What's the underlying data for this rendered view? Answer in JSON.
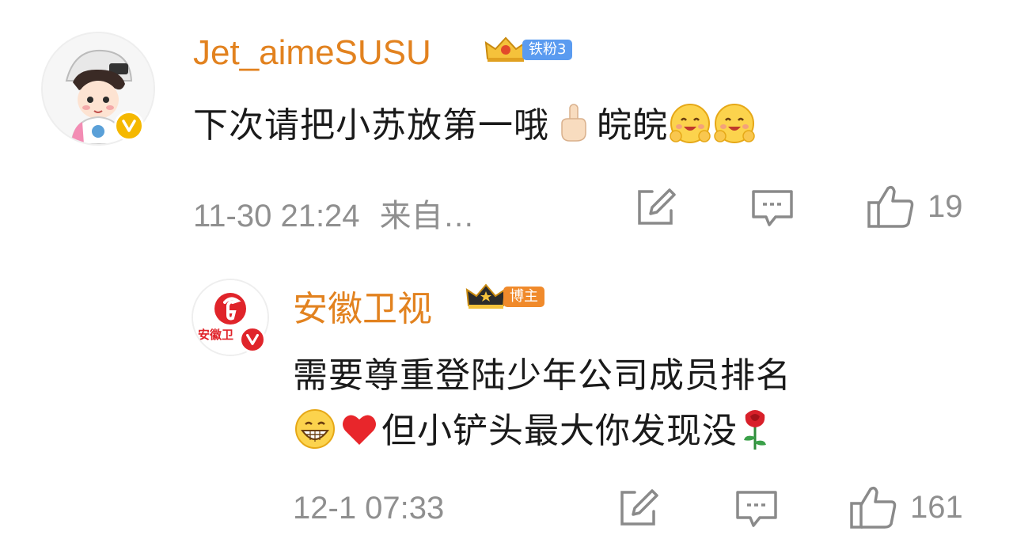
{
  "comment1": {
    "username": "Jet_aimeSUSU",
    "fan_badge": "铁粉3",
    "text": "下次请把小苏放第一哦",
    "text_suffix": "皖皖",
    "emojis": [
      "pointing-up-emoji",
      "hugging-face-emoji",
      "hugging-face-emoji"
    ],
    "time": "11-30 21:24",
    "source": "来自…",
    "likes": "19",
    "badge_color": "#5a9bf0",
    "name_color": "#e2821f"
  },
  "comment2": {
    "username": "安徽卫视",
    "role_badge": "博主",
    "avatar_text": "安徽卫",
    "text_line1": "需要尊重登陆少年公司成员排名",
    "text_line2": "但小铲头最大你发现没",
    "emojis": [
      "grinning-face-emoji",
      "red-heart-emoji",
      "rose-emoji"
    ],
    "time": "12-1 07:33",
    "likes": "161",
    "badge_color": "#f08a2b",
    "name_color": "#e2821f"
  }
}
